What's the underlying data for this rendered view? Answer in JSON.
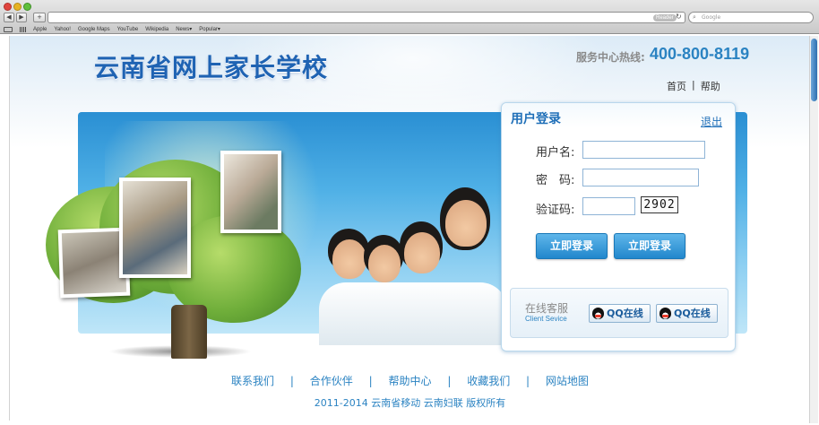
{
  "browser": {
    "reader_label": "Reader",
    "search_placeholder": "Google",
    "bookmarks": [
      "Apple",
      "Yahoo!",
      "Google Maps",
      "YouTube",
      "Wikipedia",
      "News▾",
      "Popular▾"
    ]
  },
  "header": {
    "site_title": "云南省网上家长学校",
    "hotline_label": "服务中心热线:",
    "hotline_number": "400-800-8119",
    "nav": [
      "首页",
      "|",
      "帮助"
    ]
  },
  "login": {
    "title": "用户登录",
    "logout": "退出",
    "username_label": "用户名:",
    "password_label": "密　码:",
    "captcha_label": "验证码:",
    "username_value": "",
    "password_value": "",
    "captcha_value": "",
    "captcha_image_text": "2902",
    "buttons": [
      "立即登录",
      "立即登录"
    ]
  },
  "service": {
    "title_cn": "在线客服",
    "title_en": "Client Sevice",
    "qq_buttons": [
      "QQ在线",
      "QQ在线"
    ]
  },
  "footer": {
    "links": [
      "联系我们",
      "合作伙伴",
      "帮助中心",
      "收藏我们",
      "网站地图"
    ],
    "separator": "|",
    "copyright": "2011-2014  云南省移动  云南妇联  版权所有"
  },
  "colors": {
    "brand_blue": "#1f63b3",
    "link_blue": "#2b83c2",
    "button_blue": "#2187cc"
  }
}
